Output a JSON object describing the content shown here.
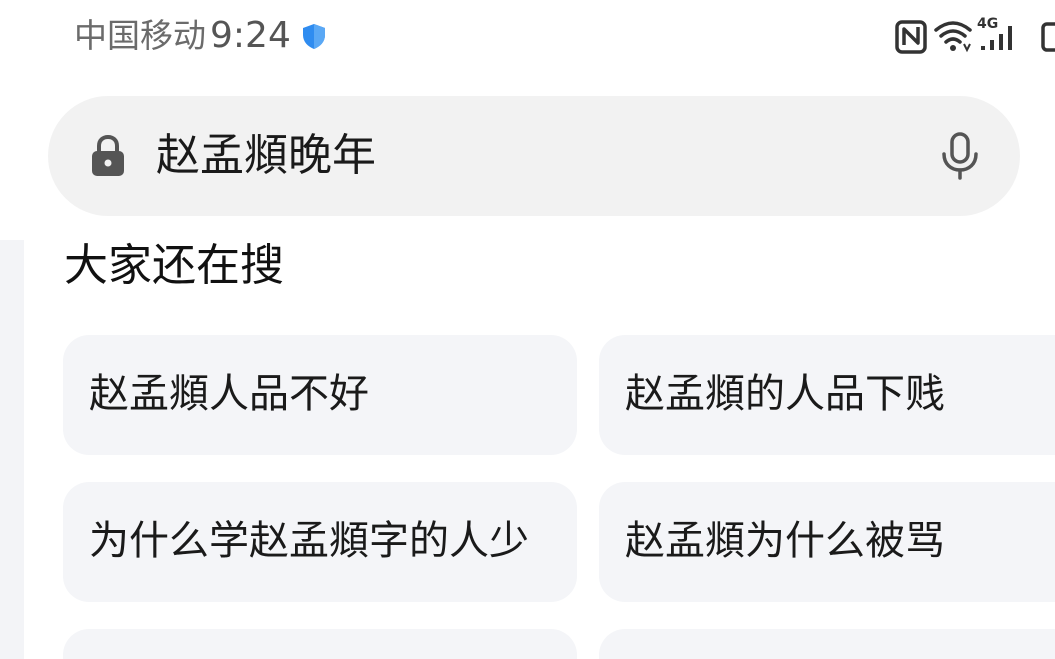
{
  "status_bar": {
    "carrier": "中国移动",
    "time": "9:24",
    "network": "4G",
    "icons": [
      "shield-icon",
      "nfc-icon",
      "wifi-icon",
      "cellular-signal-icon",
      "battery-icon"
    ]
  },
  "search": {
    "query": "赵孟頫晚年",
    "icons": [
      "lock-icon",
      "microphone-icon"
    ]
  },
  "related": {
    "title": "大家还在搜",
    "items": [
      {
        "label": "赵孟頫人品不好"
      },
      {
        "label": "赵孟頫的人品下贱"
      },
      {
        "label": "为什么学赵孟頫字的人少"
      },
      {
        "label": "赵孟頫为什么被骂"
      }
    ]
  },
  "colors": {
    "search_bg": "#f2f2f2",
    "chip_bg": "#f4f5f8",
    "shield_blue": "#2f8cf0"
  }
}
